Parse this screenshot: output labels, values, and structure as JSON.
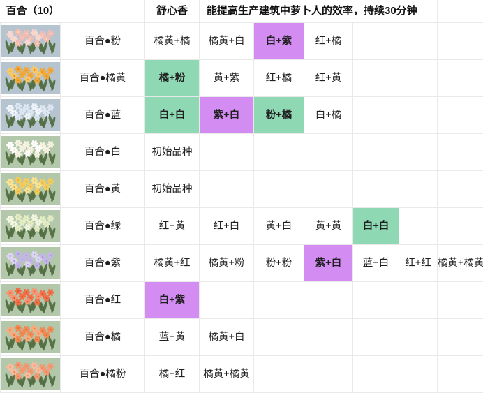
{
  "header": {
    "title": "百合（10）",
    "fragrance": "舒心香",
    "effect": "能提高生产建筑中萝卜人的效率，持续30分钟",
    "blank": ""
  },
  "colors": {
    "highlight_green": "#8ed8b3",
    "highlight_purple": "#d38cf2",
    "grid_line": "#e9e9e9",
    "thumb_bg_blue": "#b6c4cf",
    "thumb_bg_green": "#b3c7ab",
    "text": "#1f1f1f"
  },
  "rows": [
    {
      "name": "百合●粉",
      "thumb": {
        "icon": "lily-pink-thumbnail",
        "bg": "#b6c4cf",
        "petal": "#f2bcb4",
        "petal2": "#f8d6d0",
        "center": "#f6e2b0"
      },
      "recipes": [
        {
          "text": "橘黄+橘",
          "hl": "none"
        },
        {
          "text": "橘黄+白",
          "hl": "none"
        },
        {
          "text": "白+紫",
          "hl": "purple"
        },
        {
          "text": "红+橘",
          "hl": "none"
        },
        {
          "text": "",
          "hl": "none"
        },
        {
          "text": "",
          "hl": "none"
        },
        {
          "text": "",
          "hl": "none"
        }
      ]
    },
    {
      "name": "百合●橘黄",
      "thumb": {
        "icon": "lily-orange-yellow-thumbnail",
        "bg": "#b6c4cf",
        "petal": "#f0a93c",
        "petal2": "#f7c76a",
        "center": "#e08a22"
      },
      "recipes": [
        {
          "text": "橘+粉",
          "hl": "green"
        },
        {
          "text": "黄+紫",
          "hl": "none"
        },
        {
          "text": "红+橘",
          "hl": "none"
        },
        {
          "text": "红+黄",
          "hl": "none"
        },
        {
          "text": "",
          "hl": "none"
        },
        {
          "text": "",
          "hl": "none"
        },
        {
          "text": "",
          "hl": "none"
        }
      ]
    },
    {
      "name": "百合●蓝",
      "thumb": {
        "icon": "lily-blue-thumbnail",
        "bg": "#b6c4cf",
        "petal": "#dde7f2",
        "petal2": "#f0f5fa",
        "center": "#c3d4e6"
      },
      "recipes": [
        {
          "text": "白+白",
          "hl": "green"
        },
        {
          "text": "紫+白",
          "hl": "purple"
        },
        {
          "text": "粉+橘",
          "hl": "green"
        },
        {
          "text": "白+橘",
          "hl": "none"
        },
        {
          "text": "",
          "hl": "none"
        },
        {
          "text": "",
          "hl": "none"
        },
        {
          "text": "",
          "hl": "none"
        }
      ]
    },
    {
      "name": "百合●白",
      "thumb": {
        "icon": "lily-white-thumbnail",
        "bg": "#b3c7ab",
        "petal": "#f6f2e2",
        "petal2": "#ffffff",
        "center": "#eee6c6"
      },
      "recipes": [
        {
          "text": "初始品种",
          "hl": "none"
        },
        {
          "text": "",
          "hl": "none"
        },
        {
          "text": "",
          "hl": "none"
        },
        {
          "text": "",
          "hl": "none"
        },
        {
          "text": "",
          "hl": "none"
        },
        {
          "text": "",
          "hl": "none"
        },
        {
          "text": "",
          "hl": "none"
        }
      ]
    },
    {
      "name": "百合●黄",
      "thumb": {
        "icon": "lily-yellow-thumbnail",
        "bg": "#b3c7ab",
        "petal": "#f2cc5e",
        "petal2": "#f8e294",
        "center": "#e3b23c"
      },
      "recipes": [
        {
          "text": "初始品种",
          "hl": "none"
        },
        {
          "text": "",
          "hl": "none"
        },
        {
          "text": "",
          "hl": "none"
        },
        {
          "text": "",
          "hl": "none"
        },
        {
          "text": "",
          "hl": "none"
        },
        {
          "text": "",
          "hl": "none"
        },
        {
          "text": "",
          "hl": "none"
        }
      ]
    },
    {
      "name": "百合●绿",
      "thumb": {
        "icon": "lily-green-thumbnail",
        "bg": "#b3c7ab",
        "petal": "#e4ecc6",
        "petal2": "#f3f7e2",
        "center": "#d2e0a8"
      },
      "recipes": [
        {
          "text": "红+黄",
          "hl": "none"
        },
        {
          "text": "红+白",
          "hl": "none"
        },
        {
          "text": "黄+白",
          "hl": "none"
        },
        {
          "text": "黄+黄",
          "hl": "none"
        },
        {
          "text": "白+白",
          "hl": "green"
        },
        {
          "text": "",
          "hl": "none"
        },
        {
          "text": "",
          "hl": "none"
        }
      ]
    },
    {
      "name": "百合●紫",
      "thumb": {
        "icon": "lily-purple-thumbnail",
        "bg": "#b3c7ab",
        "petal": "#c3b6e8",
        "petal2": "#ddd5f2",
        "center": "#a896dc"
      },
      "recipes": [
        {
          "text": "橘黄+红",
          "hl": "none"
        },
        {
          "text": "橘黄+粉",
          "hl": "none"
        },
        {
          "text": "粉+粉",
          "hl": "none"
        },
        {
          "text": "紫+白",
          "hl": "purple"
        },
        {
          "text": "蓝+白",
          "hl": "none"
        },
        {
          "text": "红+红",
          "hl": "none"
        },
        {
          "text": "橘黄+橘黄",
          "hl": "none"
        }
      ]
    },
    {
      "name": "百合●红",
      "thumb": {
        "icon": "lily-red-thumbnail",
        "bg": "#b3c7ab",
        "petal": "#ef7048",
        "petal2": "#f59470",
        "center": "#d8562f"
      },
      "recipes": [
        {
          "text": "白+紫",
          "hl": "purple"
        },
        {
          "text": "",
          "hl": "none"
        },
        {
          "text": "",
          "hl": "none"
        },
        {
          "text": "",
          "hl": "none"
        },
        {
          "text": "",
          "hl": "none"
        },
        {
          "text": "",
          "hl": "none"
        },
        {
          "text": "",
          "hl": "none"
        }
      ]
    },
    {
      "name": "百合●橘",
      "thumb": {
        "icon": "lily-orange-thumbnail",
        "bg": "#b3c7ab",
        "petal": "#f08a52",
        "petal2": "#f7ab7c",
        "center": "#e0703a"
      },
      "recipes": [
        {
          "text": "蓝+黄",
          "hl": "none"
        },
        {
          "text": "橘黄+白",
          "hl": "none"
        },
        {
          "text": "",
          "hl": "none"
        },
        {
          "text": "",
          "hl": "none"
        },
        {
          "text": "",
          "hl": "none"
        },
        {
          "text": "",
          "hl": "none"
        },
        {
          "text": "",
          "hl": "none"
        }
      ]
    },
    {
      "name": "百合●橘粉",
      "thumb": {
        "icon": "lily-orange-pink-thumbnail",
        "bg": "#b3c7ab",
        "petal": "#f29a74",
        "petal2": "#f8bb9c",
        "center": "#e8815a"
      },
      "recipes": [
        {
          "text": "橘+红",
          "hl": "none"
        },
        {
          "text": "橘黄+橘黄",
          "hl": "none"
        },
        {
          "text": "",
          "hl": "none"
        },
        {
          "text": "",
          "hl": "none"
        },
        {
          "text": "",
          "hl": "none"
        },
        {
          "text": "",
          "hl": "none"
        },
        {
          "text": "",
          "hl": "none"
        }
      ]
    }
  ]
}
